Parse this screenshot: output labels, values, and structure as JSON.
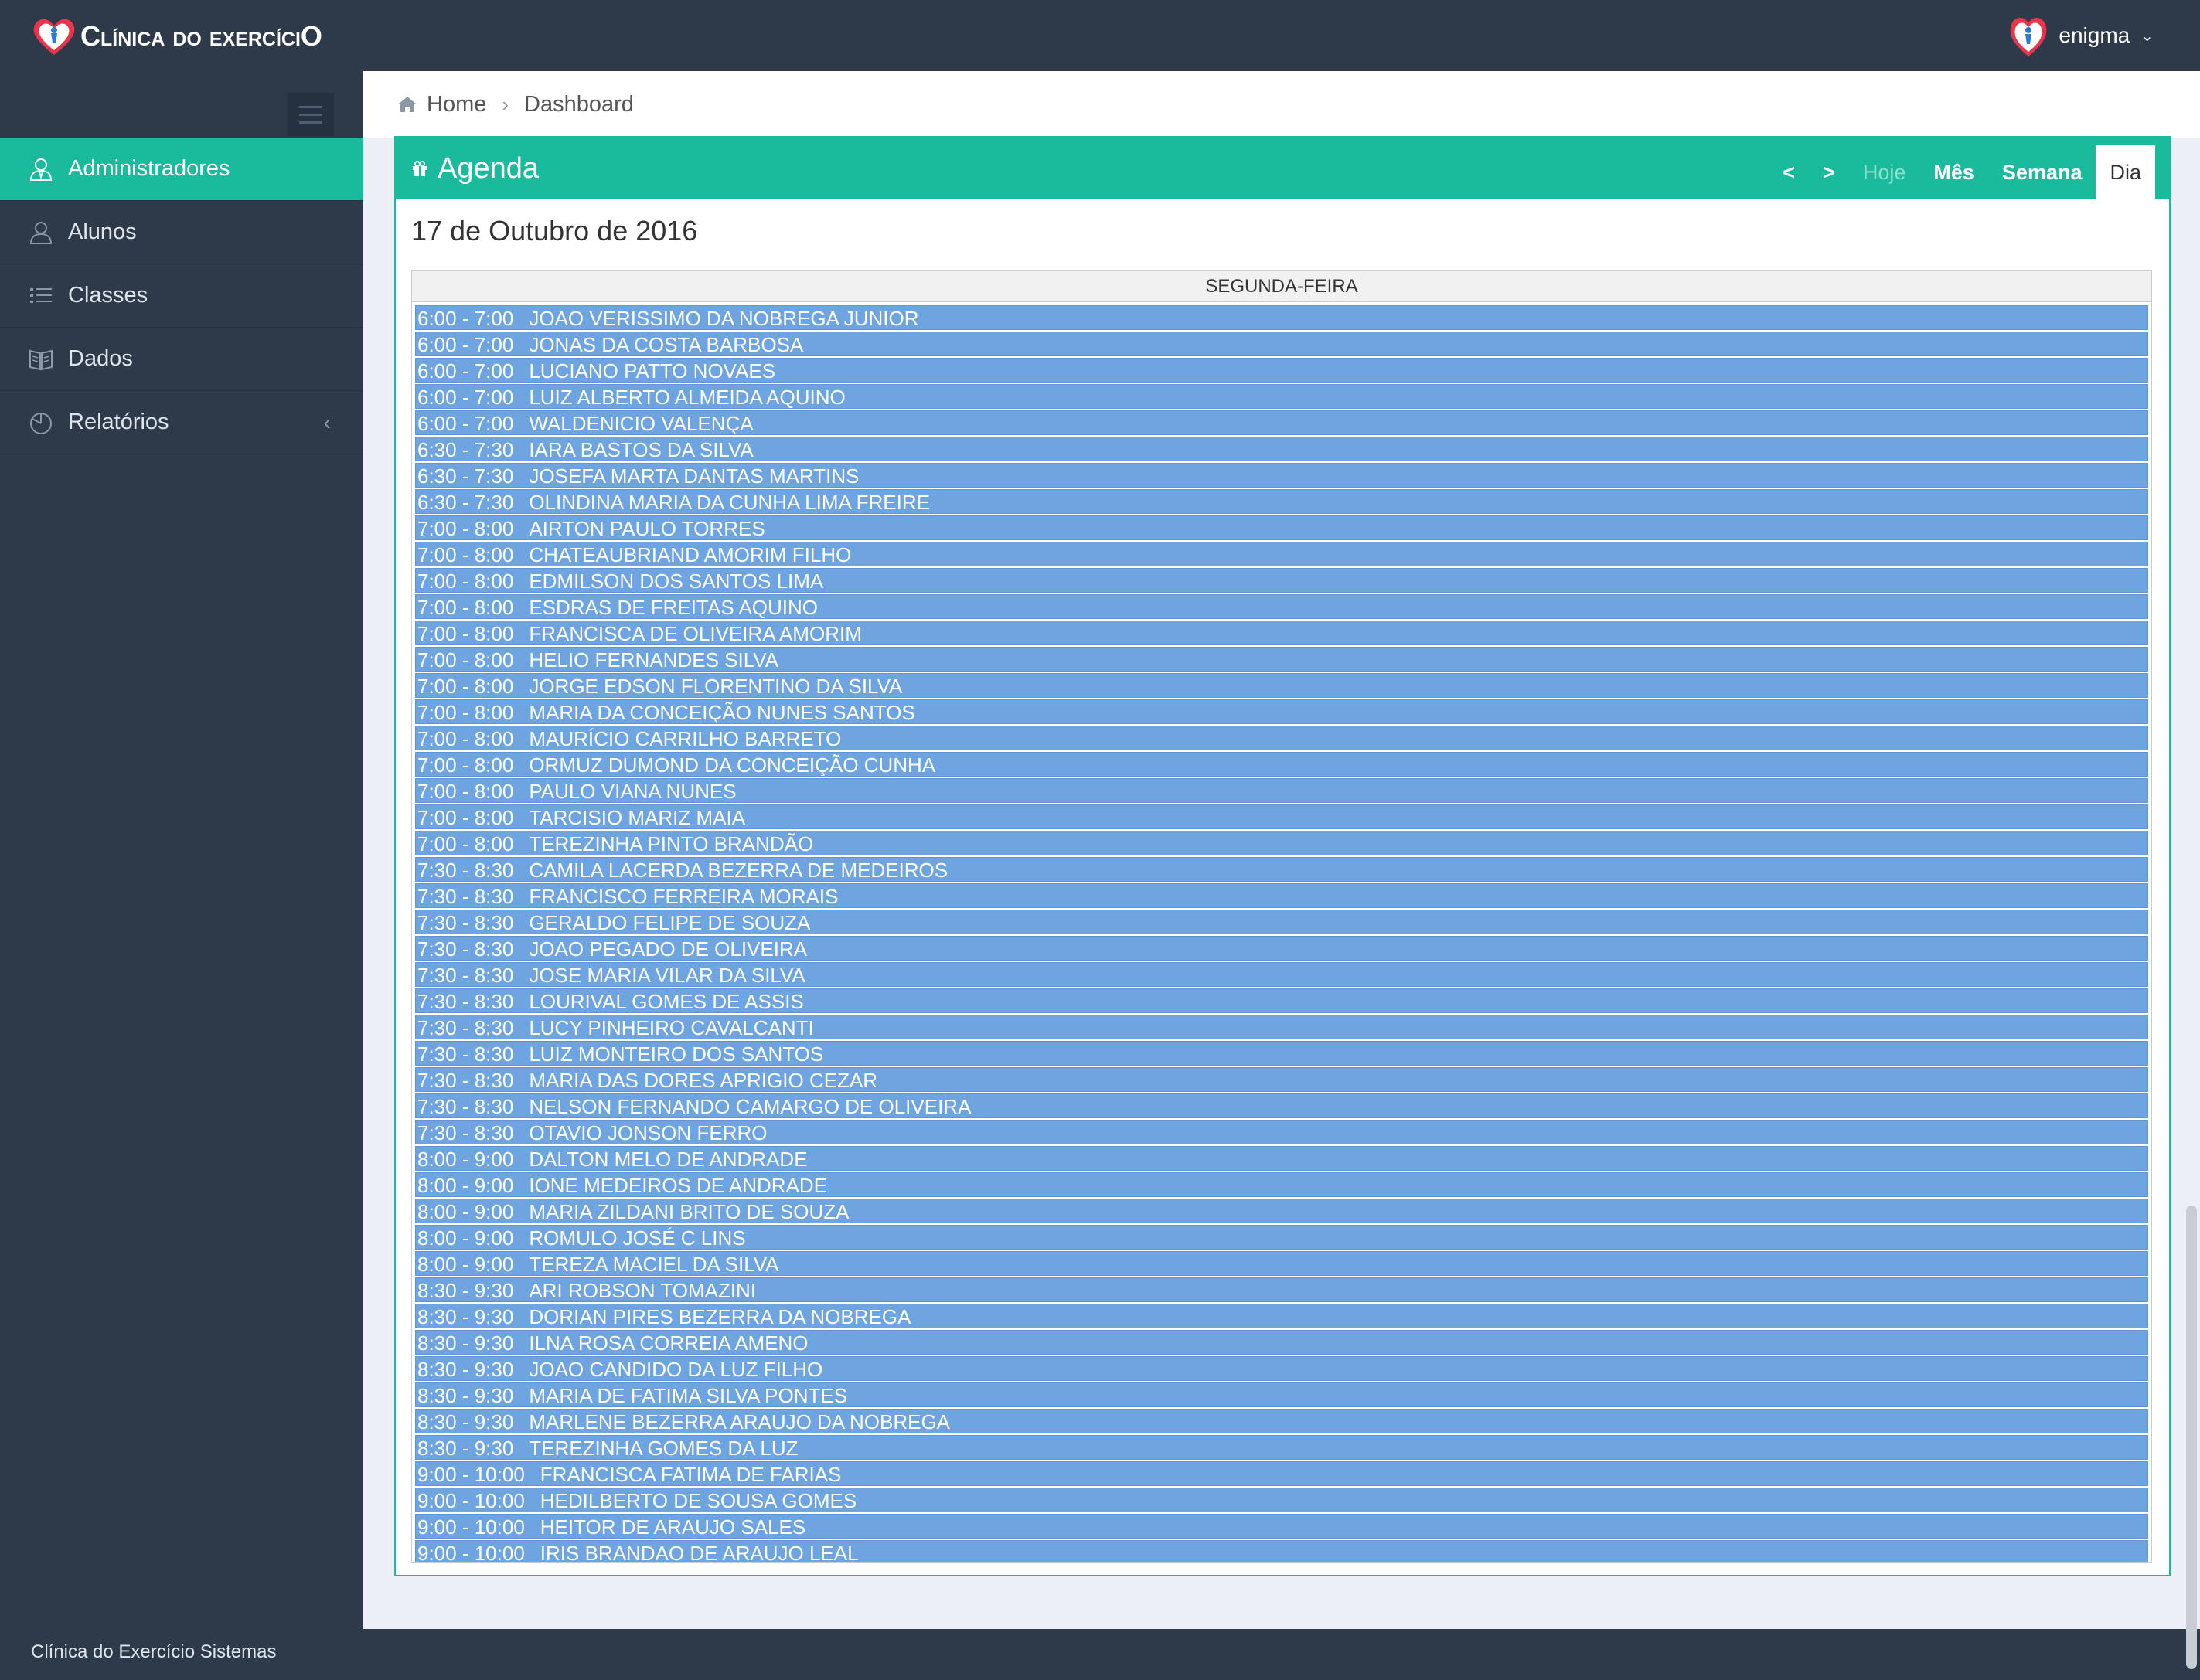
{
  "app": {
    "logo_text": "Clínica do exercíciO",
    "user_name": "enigma"
  },
  "sidebar": {
    "items": [
      {
        "label": "Administradores",
        "icon": "admin-icon",
        "active": true
      },
      {
        "label": "Alunos",
        "icon": "user-icon",
        "active": false
      },
      {
        "label": "Classes",
        "icon": "list-icon",
        "active": false
      },
      {
        "label": "Dados",
        "icon": "book-icon",
        "active": false
      },
      {
        "label": "Relatórios",
        "icon": "chart-icon",
        "active": false
      }
    ],
    "footer": "Clínica do Exercício Sistemas"
  },
  "breadcrumb": {
    "home": "Home",
    "current": "Dashboard"
  },
  "agenda": {
    "title": "Agenda",
    "nav": {
      "prev": "<",
      "next": ">",
      "today": "Hoje",
      "month": "Mês",
      "week": "Semana",
      "day": "Dia"
    },
    "date": "17 de Outubro de 2016",
    "day_header": "SEGUNDA-FEIRA",
    "events": [
      {
        "time": "6:00 - 7:00",
        "name": "JOAO VERISSIMO DA NOBREGA JUNIOR"
      },
      {
        "time": "6:00 - 7:00",
        "name": "JONAS DA COSTA BARBOSA"
      },
      {
        "time": "6:00 - 7:00",
        "name": "LUCIANO PATTO NOVAES"
      },
      {
        "time": "6:00 - 7:00",
        "name": "LUIZ ALBERTO ALMEIDA AQUINO"
      },
      {
        "time": "6:00 - 7:00",
        "name": "WALDENICIO VALENÇA"
      },
      {
        "time": "6:30 - 7:30",
        "name": "IARA BASTOS DA SILVA"
      },
      {
        "time": "6:30 - 7:30",
        "name": "JOSEFA MARTA DANTAS MARTINS"
      },
      {
        "time": "6:30 - 7:30",
        "name": "OLINDINA MARIA DA CUNHA LIMA FREIRE"
      },
      {
        "time": "7:00 - 8:00",
        "name": "AIRTON PAULO TORRES"
      },
      {
        "time": "7:00 - 8:00",
        "name": "CHATEAUBRIAND AMORIM FILHO"
      },
      {
        "time": "7:00 - 8:00",
        "name": "EDMILSON DOS SANTOS LIMA"
      },
      {
        "time": "7:00 - 8:00",
        "name": "ESDRAS DE FREITAS AQUINO"
      },
      {
        "time": "7:00 - 8:00",
        "name": "FRANCISCA DE OLIVEIRA AMORIM"
      },
      {
        "time": "7:00 - 8:00",
        "name": "HELIO FERNANDES SILVA"
      },
      {
        "time": "7:00 - 8:00",
        "name": "JORGE EDSON FLORENTINO DA SILVA"
      },
      {
        "time": "7:00 - 8:00",
        "name": "MARIA DA CONCEIÇÃO NUNES SANTOS"
      },
      {
        "time": "7:00 - 8:00",
        "name": "MAURÍCIO CARRILHO BARRETO"
      },
      {
        "time": "7:00 - 8:00",
        "name": "ORMUZ DUMOND DA CONCEIÇÃO CUNHA"
      },
      {
        "time": "7:00 - 8:00",
        "name": "PAULO VIANA NUNES"
      },
      {
        "time": "7:00 - 8:00",
        "name": "TARCISIO MARIZ MAIA"
      },
      {
        "time": "7:00 - 8:00",
        "name": "TEREZINHA PINTO BRANDÃO"
      },
      {
        "time": "7:30 - 8:30",
        "name": "CAMILA LACERDA BEZERRA DE MEDEIROS"
      },
      {
        "time": "7:30 - 8:30",
        "name": "FRANCISCO FERREIRA MORAIS"
      },
      {
        "time": "7:30 - 8:30",
        "name": "GERALDO FELIPE DE SOUZA"
      },
      {
        "time": "7:30 - 8:30",
        "name": "JOAO PEGADO DE OLIVEIRA"
      },
      {
        "time": "7:30 - 8:30",
        "name": "JOSE MARIA VILAR DA SILVA"
      },
      {
        "time": "7:30 - 8:30",
        "name": "LOURIVAL GOMES DE ASSIS"
      },
      {
        "time": "7:30 - 8:30",
        "name": "LUCY PINHEIRO CAVALCANTI"
      },
      {
        "time": "7:30 - 8:30",
        "name": "LUIZ MONTEIRO DOS SANTOS"
      },
      {
        "time": "7:30 - 8:30",
        "name": "MARIA DAS DORES APRIGIO CEZAR"
      },
      {
        "time": "7:30 - 8:30",
        "name": "NELSON FERNANDO CAMARGO DE OLIVEIRA"
      },
      {
        "time": "7:30 - 8:30",
        "name": "OTAVIO JONSON FERRO"
      },
      {
        "time": "8:00 - 9:00",
        "name": "DALTON MELO DE ANDRADE"
      },
      {
        "time": "8:00 - 9:00",
        "name": "IONE MEDEIROS DE ANDRADE"
      },
      {
        "time": "8:00 - 9:00",
        "name": "MARIA ZILDANI BRITO DE SOUZA"
      },
      {
        "time": "8:00 - 9:00",
        "name": "ROMULO JOSÉ C LINS"
      },
      {
        "time": "8:00 - 9:00",
        "name": "TEREZA MACIEL DA SILVA"
      },
      {
        "time": "8:30 - 9:30",
        "name": "ARI ROBSON TOMAZINI"
      },
      {
        "time": "8:30 - 9:30",
        "name": "DORIAN PIRES BEZERRA DA NOBREGA"
      },
      {
        "time": "8:30 - 9:30",
        "name": "ILNA ROSA CORREIA AMENO"
      },
      {
        "time": "8:30 - 9:30",
        "name": "JOAO CANDIDO DA LUZ FILHO"
      },
      {
        "time": "8:30 - 9:30",
        "name": "MARIA DE FATIMA SILVA PONTES"
      },
      {
        "time": "8:30 - 9:30",
        "name": "MARLENE BEZERRA ARAUJO DA NOBREGA"
      },
      {
        "time": "8:30 - 9:30",
        "name": "TEREZINHA GOMES DA LUZ"
      },
      {
        "time": "9:00 - 10:00",
        "name": "FRANCISCA FATIMA DE FARIAS"
      },
      {
        "time": "9:00 - 10:00",
        "name": "HEDILBERTO DE SOUSA GOMES"
      },
      {
        "time": "9:00 - 10:00",
        "name": "HEITOR DE ARAUJO SALES"
      },
      {
        "time": "9:00 - 10:00",
        "name": "IRIS BRANDAO DE ARAUJO LEAL"
      }
    ]
  },
  "colors": {
    "sidebar_bg": "#2e3a4a",
    "accent": "#1abb9c",
    "event_bg": "#6ea4e0",
    "content_bg": "#ecf0f6"
  }
}
